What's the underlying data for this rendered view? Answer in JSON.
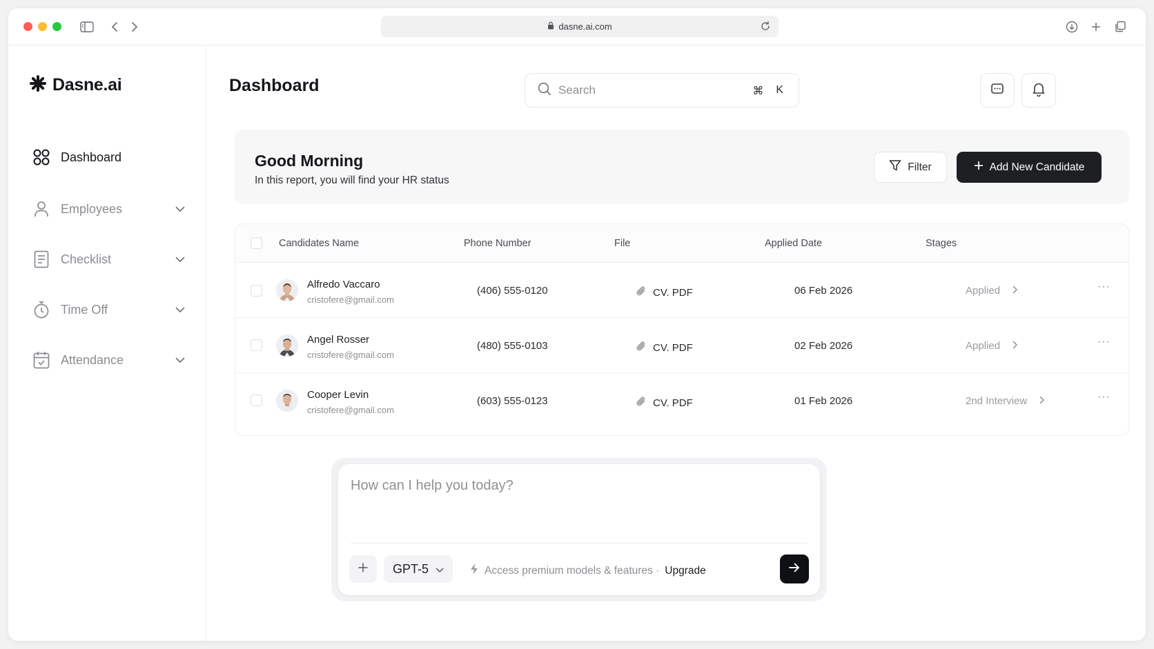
{
  "browser": {
    "url": "dasne.ai.com"
  },
  "sidebar": {
    "logo_text": "Dasne.ai",
    "items": [
      {
        "label": "Dashboard",
        "icon": "grid-icon",
        "active": true
      },
      {
        "label": "Employees",
        "icon": "user-icon",
        "active": false
      },
      {
        "label": "Checklist",
        "icon": "checklist-icon",
        "active": false
      },
      {
        "label": "Time Off",
        "icon": "stopwatch-icon",
        "active": false
      },
      {
        "label": "Attendance",
        "icon": "calendar-icon",
        "active": false
      }
    ]
  },
  "header": {
    "title": "Dashboard",
    "search_placeholder": "Search",
    "shortcut_symbol": "⌘",
    "shortcut_key": "K"
  },
  "greeting": {
    "title": "Good Morning",
    "subtitle": "In this report, you will find your HR status",
    "filter_label": "Filter",
    "add_label": "Add New Candidate"
  },
  "table": {
    "columns": [
      "Candidates Name",
      "Phone Number",
      "File",
      "Applied Date",
      "Stages"
    ],
    "rows": [
      {
        "name": "Alfredo Vaccaro",
        "email": "cristofere@gmail.com",
        "phone": "(406) 555-0120",
        "file": "CV. PDF",
        "date": "06 Feb 2026",
        "stage": "Applied",
        "more": "···"
      },
      {
        "name": "Angel Rosser",
        "email": "cristofere@gmail.com",
        "phone": "(480) 555-0103",
        "file": "CV. PDF",
        "date": "02 Feb 2026",
        "stage": "Applied",
        "more": "···"
      },
      {
        "name": "Cooper Levin",
        "email": "cristofere@gmail.com",
        "phone": "(603) 555-0123",
        "file": "CV. PDF",
        "date": "01 Feb 2026",
        "stage": "2nd Interview",
        "more": "···"
      }
    ]
  },
  "chat": {
    "placeholder": "How can I help you today?",
    "model": "GPT-5",
    "premium_text": "Access premium models & features ·",
    "upgrade_label": "Upgrade"
  },
  "colors": {
    "primary_dark": "#1e1f23",
    "muted_text": "#8e8f94",
    "card_bg": "#f7f7f8"
  }
}
